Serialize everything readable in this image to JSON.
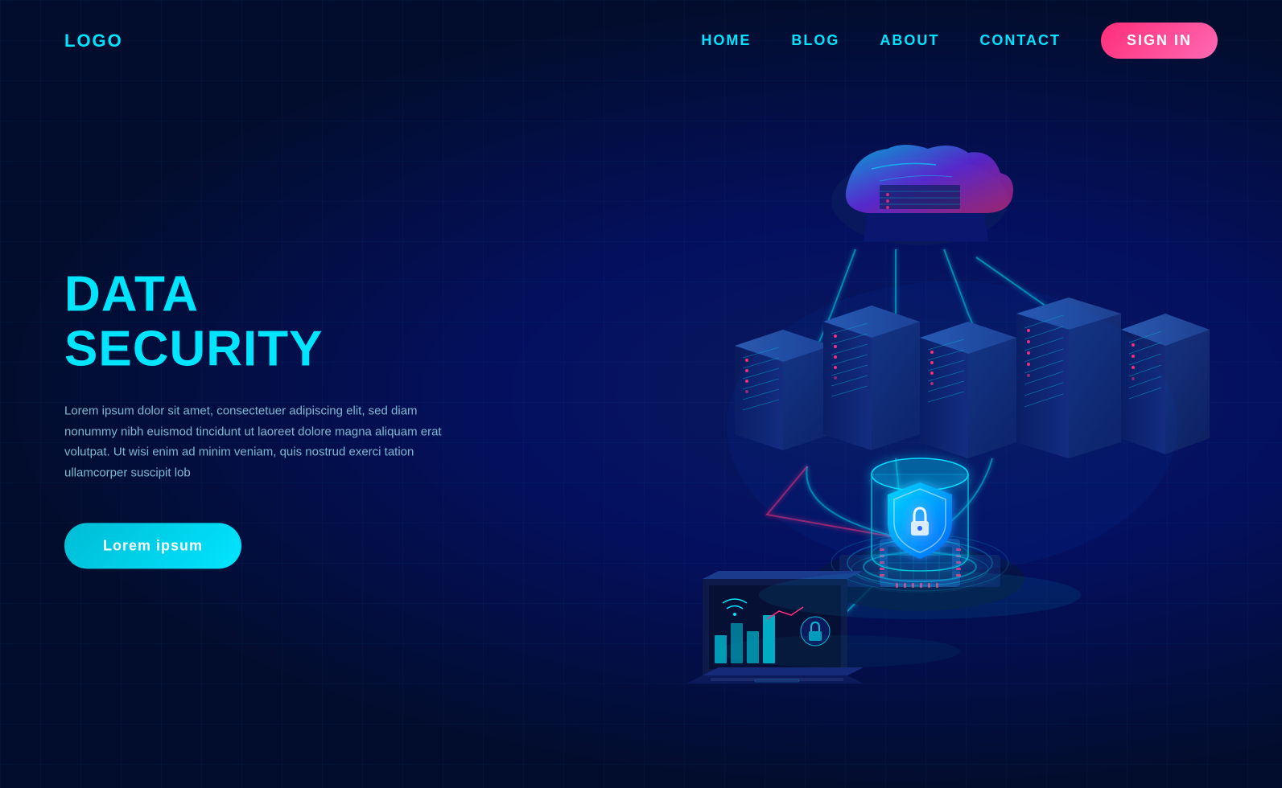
{
  "nav": {
    "logo": "LOGO",
    "links": [
      {
        "label": "HOME",
        "id": "home"
      },
      {
        "label": "BLOG",
        "id": "blog"
      },
      {
        "label": "ABOUT",
        "id": "about"
      },
      {
        "label": "CONTACT",
        "id": "contact"
      }
    ],
    "signin": "SIGN IN"
  },
  "hero": {
    "title": "DATA SECURITY",
    "description": "Lorem ipsum dolor sit amet, consectetuer adipiscing elit, sed diam nonummy nibh euismod tincidunt ut laoreet dolore magna aliquam erat volutpat. Ut wisi enim ad minim veniam, quis nostrud exerci tation ullamcorper suscipit lob",
    "cta": "Lorem ipsum"
  },
  "colors": {
    "cyan": "#00e5ff",
    "dark_bg": "#020d2e",
    "mid_bg": "#041060",
    "pink": "#ff2d78",
    "text_muted": "#7cb8d0"
  }
}
